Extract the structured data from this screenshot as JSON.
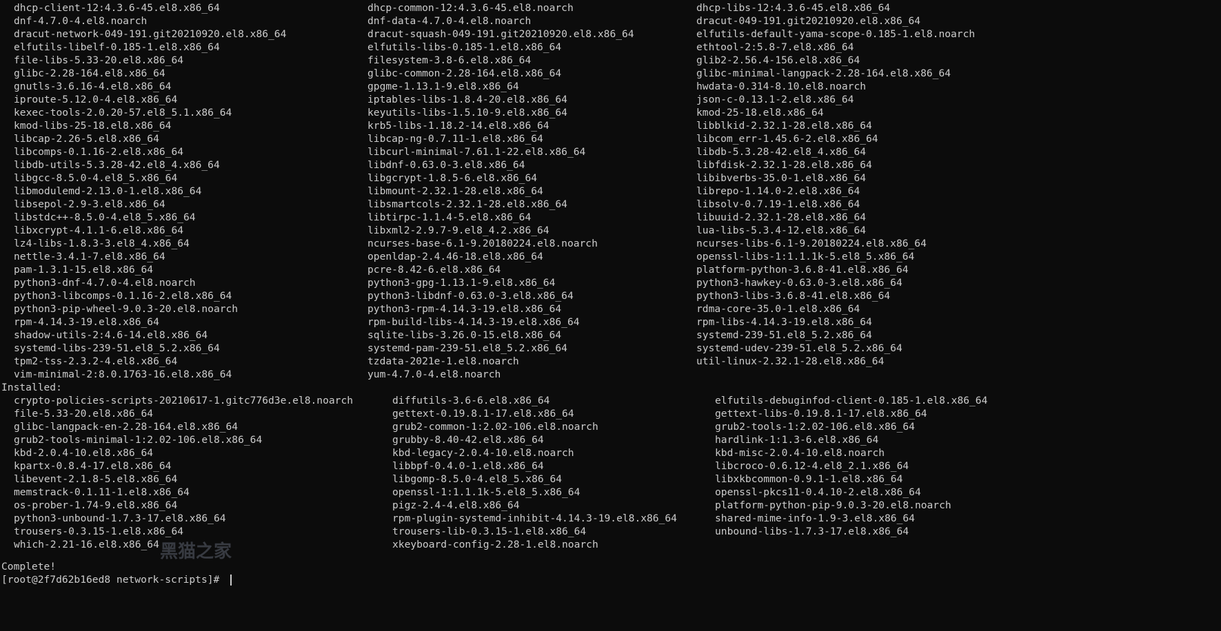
{
  "colors": {
    "background": "#0c0c0c",
    "text": "#cccccc",
    "watermark": "#3a3d44"
  },
  "upgraded_rows": [
    [
      "dhcp-client-12:4.3.6-45.el8.x86_64",
      "dhcp-common-12:4.3.6-45.el8.noarch",
      "dhcp-libs-12:4.3.6-45.el8.x86_64"
    ],
    [
      "dnf-4.7.0-4.el8.noarch",
      "dnf-data-4.7.0-4.el8.noarch",
      "dracut-049-191.git20210920.el8.x86_64"
    ],
    [
      "dracut-network-049-191.git20210920.el8.x86_64",
      "dracut-squash-049-191.git20210920.el8.x86_64",
      "elfutils-default-yama-scope-0.185-1.el8.noarch"
    ],
    [
      "elfutils-libelf-0.185-1.el8.x86_64",
      "elfutils-libs-0.185-1.el8.x86_64",
      "ethtool-2:5.8-7.el8.x86_64"
    ],
    [
      "file-libs-5.33-20.el8.x86_64",
      "filesystem-3.8-6.el8.x86_64",
      "glib2-2.56.4-156.el8.x86_64"
    ],
    [
      "glibc-2.28-164.el8.x86_64",
      "glibc-common-2.28-164.el8.x86_64",
      "glibc-minimal-langpack-2.28-164.el8.x86_64"
    ],
    [
      "gnutls-3.6.16-4.el8.x86_64",
      "gpgme-1.13.1-9.el8.x86_64",
      "hwdata-0.314-8.10.el8.noarch"
    ],
    [
      "iproute-5.12.0-4.el8.x86_64",
      "iptables-libs-1.8.4-20.el8.x86_64",
      "json-c-0.13.1-2.el8.x86_64"
    ],
    [
      "kexec-tools-2.0.20-57.el8_5.1.x86_64",
      "keyutils-libs-1.5.10-9.el8.x86_64",
      "kmod-25-18.el8.x86_64"
    ],
    [
      "kmod-libs-25-18.el8.x86_64",
      "krb5-libs-1.18.2-14.el8.x86_64",
      "libblkid-2.32.1-28.el8.x86_64"
    ],
    [
      "libcap-2.26-5.el8.x86_64",
      "libcap-ng-0.7.11-1.el8.x86_64",
      "libcom_err-1.45.6-2.el8.x86_64"
    ],
    [
      "libcomps-0.1.16-2.el8.x86_64",
      "libcurl-minimal-7.61.1-22.el8.x86_64",
      "libdb-5.3.28-42.el8_4.x86_64"
    ],
    [
      "libdb-utils-5.3.28-42.el8_4.x86_64",
      "libdnf-0.63.0-3.el8.x86_64",
      "libfdisk-2.32.1-28.el8.x86_64"
    ],
    [
      "libgcc-8.5.0-4.el8_5.x86_64",
      "libgcrypt-1.8.5-6.el8.x86_64",
      "libibverbs-35.0-1.el8.x86_64"
    ],
    [
      "libmodulemd-2.13.0-1.el8.x86_64",
      "libmount-2.32.1-28.el8.x86_64",
      "librepo-1.14.0-2.el8.x86_64"
    ],
    [
      "libsepol-2.9-3.el8.x86_64",
      "libsmartcols-2.32.1-28.el8.x86_64",
      "libsolv-0.7.19-1.el8.x86_64"
    ],
    [
      "libstdc++-8.5.0-4.el8_5.x86_64",
      "libtirpc-1.1.4-5.el8.x86_64",
      "libuuid-2.32.1-28.el8.x86_64"
    ],
    [
      "libxcrypt-4.1.1-6.el8.x86_64",
      "libxml2-2.9.7-9.el8_4.2.x86_64",
      "lua-libs-5.3.4-12.el8.x86_64"
    ],
    [
      "lz4-libs-1.8.3-3.el8_4.x86_64",
      "ncurses-base-6.1-9.20180224.el8.noarch",
      "ncurses-libs-6.1-9.20180224.el8.x86_64"
    ],
    [
      "nettle-3.4.1-7.el8.x86_64",
      "openldap-2.4.46-18.el8.x86_64",
      "openssl-libs-1:1.1.1k-5.el8_5.x86_64"
    ],
    [
      "pam-1.3.1-15.el8.x86_64",
      "pcre-8.42-6.el8.x86_64",
      "platform-python-3.6.8-41.el8.x86_64"
    ],
    [
      "python3-dnf-4.7.0-4.el8.noarch",
      "python3-gpg-1.13.1-9.el8.x86_64",
      "python3-hawkey-0.63.0-3.el8.x86_64"
    ],
    [
      "python3-libcomps-0.1.16-2.el8.x86_64",
      "python3-libdnf-0.63.0-3.el8.x86_64",
      "python3-libs-3.6.8-41.el8.x86_64"
    ],
    [
      "python3-pip-wheel-9.0.3-20.el8.noarch",
      "python3-rpm-4.14.3-19.el8.x86_64",
      "rdma-core-35.0-1.el8.x86_64"
    ],
    [
      "rpm-4.14.3-19.el8.x86_64",
      "rpm-build-libs-4.14.3-19.el8.x86_64",
      "rpm-libs-4.14.3-19.el8.x86_64"
    ],
    [
      "shadow-utils-2:4.6-14.el8.x86_64",
      "sqlite-libs-3.26.0-15.el8.x86_64",
      "systemd-239-51.el8_5.2.x86_64"
    ],
    [
      "systemd-libs-239-51.el8_5.2.x86_64",
      "systemd-pam-239-51.el8_5.2.x86_64",
      "systemd-udev-239-51.el8_5.2.x86_64"
    ],
    [
      "tpm2-tss-2.3.2-4.el8.x86_64",
      "tzdata-2021e-1.el8.noarch",
      "util-linux-2.32.1-28.el8.x86_64"
    ],
    [
      "vim-minimal-2:8.0.1763-16.el8.x86_64",
      "yum-4.7.0-4.el8.noarch",
      ""
    ]
  ],
  "installed_header": "Installed:",
  "installed_rows": [
    [
      "crypto-policies-scripts-20210617-1.gitc776d3e.el8.noarch",
      "diffutils-3.6-6.el8.x86_64",
      "elfutils-debuginfod-client-0.185-1.el8.x86_64"
    ],
    [
      "file-5.33-20.el8.x86_64",
      "gettext-0.19.8.1-17.el8.x86_64",
      "gettext-libs-0.19.8.1-17.el8.x86_64"
    ],
    [
      "glibc-langpack-en-2.28-164.el8.x86_64",
      "grub2-common-1:2.02-106.el8.noarch",
      "grub2-tools-1:2.02-106.el8.x86_64"
    ],
    [
      "grub2-tools-minimal-1:2.02-106.el8.x86_64",
      "grubby-8.40-42.el8.x86_64",
      "hardlink-1:1.3-6.el8.x86_64"
    ],
    [
      "kbd-2.0.4-10.el8.x86_64",
      "kbd-legacy-2.0.4-10.el8.noarch",
      "kbd-misc-2.0.4-10.el8.noarch"
    ],
    [
      "kpartx-0.8.4-17.el8.x86_64",
      "libbpf-0.4.0-1.el8.x86_64",
      "libcroco-0.6.12-4.el8_2.1.x86_64"
    ],
    [
      "libevent-2.1.8-5.el8.x86_64",
      "libgomp-8.5.0-4.el8_5.x86_64",
      "libxkbcommon-0.9.1-1.el8.x86_64"
    ],
    [
      "memstrack-0.1.11-1.el8.x86_64",
      "openssl-1:1.1.1k-5.el8_5.x86_64",
      "openssl-pkcs11-0.4.10-2.el8.x86_64"
    ],
    [
      "os-prober-1.74-9.el8.x86_64",
      "pigz-2.4-4.el8.x86_64",
      "platform-python-pip-9.0.3-20.el8.noarch"
    ],
    [
      "python3-unbound-1.7.3-17.el8.x86_64",
      "rpm-plugin-systemd-inhibit-4.14.3-19.el8.x86_64",
      "shared-mime-info-1.9-3.el8.x86_64"
    ],
    [
      "trousers-0.3.15-1.el8.x86_64",
      "trousers-lib-0.3.15-1.el8.x86_64",
      "unbound-libs-1.7.3-17.el8.x86_64"
    ],
    [
      "which-2.21-16.el8.x86_64",
      "xkeyboard-config-2.28-1.el8.noarch",
      ""
    ]
  ],
  "complete_text": "Complete!",
  "prompt_text": "[root@2f7d62b16ed8 network-scripts]# ",
  "watermark_text": "黑猫之家"
}
